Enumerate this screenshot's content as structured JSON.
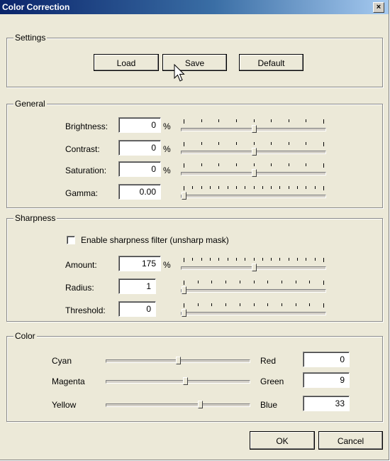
{
  "window": {
    "title": "Color Correction",
    "close_glyph": "×"
  },
  "settings": {
    "legend": "Settings",
    "load": "Load",
    "save": "Save",
    "default": "Default"
  },
  "general": {
    "legend": "General",
    "brightness": {
      "label": "Brightness:",
      "value": "0",
      "unit": "%",
      "slider": 0.5
    },
    "contrast": {
      "label": "Contrast:",
      "value": "0",
      "unit": "%",
      "slider": 0.5
    },
    "saturation": {
      "label": "Saturation:",
      "value": "0",
      "unit": "%",
      "slider": 0.5
    },
    "gamma": {
      "label": "Gamma:",
      "value": "0.00",
      "slider": 0.0
    }
  },
  "sharpness": {
    "legend": "Sharpness",
    "enable_label": "Enable sharpness filter (unsharp mask)",
    "enable_checked": false,
    "amount": {
      "label": "Amount:",
      "value": "175",
      "unit": "%",
      "slider": 0.5
    },
    "radius": {
      "label": "Radius:",
      "value": "1",
      "slider": 0.0
    },
    "threshold": {
      "label": "Threshold:",
      "value": "0",
      "slider": 0.0
    }
  },
  "color": {
    "legend": "Color",
    "cyan": {
      "left": "Cyan",
      "right": "Red",
      "value": "0",
      "slider": 0.5
    },
    "magenta": {
      "left": "Magenta",
      "right": "Green",
      "value": "9",
      "slider": 0.55
    },
    "yellow": {
      "left": "Yellow",
      "right": "Blue",
      "value": "33",
      "slider": 0.66
    }
  },
  "buttons": {
    "ok": "OK",
    "cancel": "Cancel"
  }
}
